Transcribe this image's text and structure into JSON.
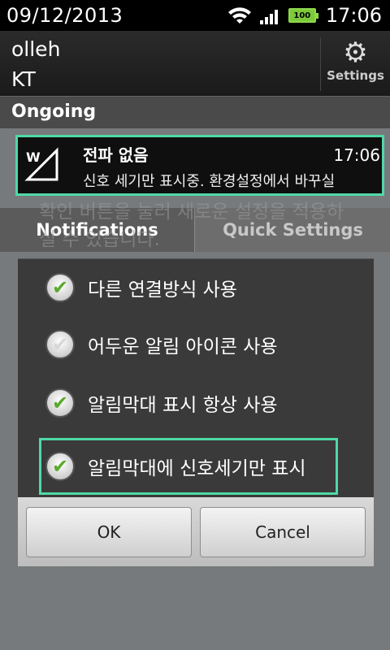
{
  "status": {
    "date": "09/12/2013",
    "time": "17:06",
    "battery": "100"
  },
  "carrier": {
    "line1": "olleh",
    "line2": "KT",
    "settings_label": "Settings"
  },
  "ongoing": {
    "header": "Ongoing"
  },
  "notification": {
    "title": "전파 없음",
    "time": "17:06",
    "body": "신호 세기만 표시중. 환경설정에서 바꾸실"
  },
  "background": {
    "text": "확인 버튼을 눌러 새로운 설정을 적용하실 수 있습니다.",
    "tab_notifications": "Notifications",
    "tab_quick_settings": "Quick Settings"
  },
  "dialog": {
    "options": [
      {
        "label": "다른 연결방식 사용",
        "checked": true
      },
      {
        "label": "어두운 알림 아이콘 사용",
        "checked": false
      },
      {
        "label": "알림막대 표시 항상 사용",
        "checked": true
      },
      {
        "label": "알림막대에 신호세기만 표시",
        "checked": true
      }
    ],
    "ok_label": "OK",
    "cancel_label": "Cancel"
  },
  "colors": {
    "highlight": "#4fd9a6",
    "check": "#5aa92c"
  }
}
